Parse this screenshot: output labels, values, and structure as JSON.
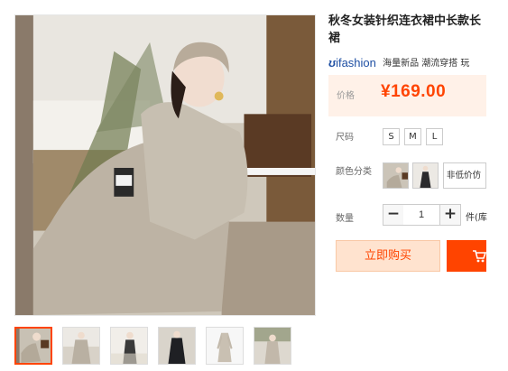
{
  "product": {
    "title": "秋冬女装针织连衣裙中长款长裙",
    "brand": {
      "logo_text": "ifashion",
      "tagline": "海量新品 潮流穿搭 玩",
      "logo_color": "#1e4fa3"
    },
    "price": {
      "label": "价格",
      "value": "¥169.00",
      "color": "#ff4400"
    }
  },
  "options": {
    "size_label": "尺码",
    "sizes": [
      "S",
      "M",
      "L"
    ],
    "color_label": "颜色分类",
    "color_text_option": "非低价仿",
    "color_swatches": [
      "sofa-photo",
      "dark-dress-photo"
    ]
  },
  "quantity": {
    "label": "数量",
    "minus": "−",
    "value": "1",
    "plus": "+",
    "unit": "件(库"
  },
  "actions": {
    "buy_now": "立即购买",
    "accent": "#ff4400"
  },
  "gallery": {
    "thumbnail_count": 6,
    "active_index": 0
  }
}
